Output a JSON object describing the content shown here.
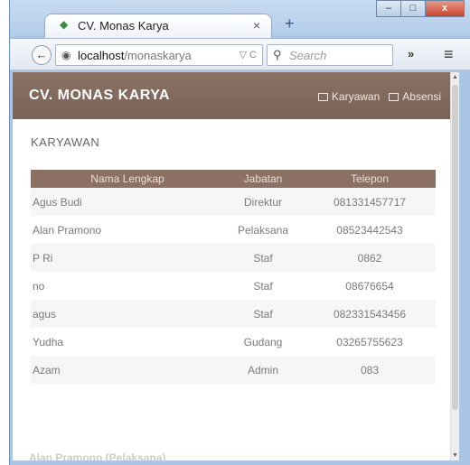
{
  "browser": {
    "tab_title": "CV. Monas Karya",
    "url_host": "localhost",
    "url_path": "/monaskarya",
    "search_placeholder": "Search",
    "window_buttons": {
      "minimize": "–",
      "maximize": "□",
      "close": "x"
    }
  },
  "app": {
    "brand": "CV. MONAS KARYA",
    "nav": [
      {
        "label": "Karyawan"
      },
      {
        "label": "Absensi"
      }
    ],
    "section_title": "KARYAWAN",
    "table": {
      "columns": [
        "Nama Lengkap",
        "Jabatan",
        "Telepon"
      ],
      "rows": [
        {
          "name": "Agus Budi",
          "jabatan": "Direktur",
          "telepon": "081331457717"
        },
        {
          "name": "Alan Pramono",
          "jabatan": "Pelaksana",
          "telepon": "08523442543"
        },
        {
          "name": "P Ri",
          "jabatan": "Staf",
          "telepon": "0862"
        },
        {
          "name": "no",
          "jabatan": "Staf",
          "telepon": "08676654"
        },
        {
          "name": "agus",
          "jabatan": "Staf",
          "telepon": "082331543456"
        },
        {
          "name": "Yudha",
          "jabatan": "Gudang",
          "telepon": "03265755623"
        },
        {
          "name": "Azam",
          "jabatan": "Admin",
          "telepon": "083"
        }
      ]
    },
    "footer": "Alan Pramono (Pelaksana)"
  }
}
